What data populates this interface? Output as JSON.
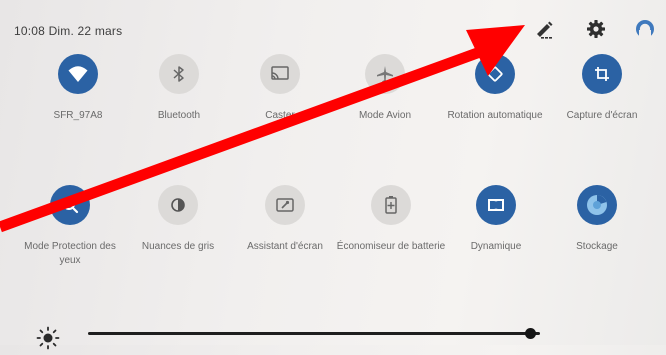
{
  "status_bar": {
    "datetime": "10:08  Dim. 22 mars"
  },
  "header_icons": [
    "edit-pencil-icon",
    "gear-icon",
    "account-icon"
  ],
  "tiles_row1": [
    {
      "label": "SFR_97A8",
      "state": "on",
      "icon": "wifi-icon"
    },
    {
      "label": "Bluetooth",
      "state": "off",
      "icon": "bluetooth-icon"
    },
    {
      "label": "Caster",
      "state": "off",
      "icon": "cast-icon"
    },
    {
      "label": "Mode Avion",
      "state": "off",
      "icon": "airplane-icon"
    },
    {
      "label": "Rotation automatique",
      "state": "on",
      "icon": "rotation-icon"
    },
    {
      "label": "Capture d'écran",
      "state": "on",
      "icon": "crop-icon"
    }
  ],
  "tiles_row2": [
    {
      "label": "Mode Protection des yeux",
      "state": "on",
      "icon": "eye-protection-icon"
    },
    {
      "label": "Nuances de gris",
      "state": "off",
      "icon": "grayscale-icon"
    },
    {
      "label": "Assistant d'écran",
      "state": "off",
      "icon": "screen-assistant-icon"
    },
    {
      "label": "Économiseur de batterie",
      "state": "off",
      "icon": "battery-saver-icon"
    },
    {
      "label": "Dynamique",
      "state": "on",
      "icon": "dolby-icon"
    },
    {
      "label": "Stockage",
      "state": "on",
      "icon": "storage-icon"
    }
  ],
  "brightness": {
    "icon": "brightness-icon",
    "level": 0.98
  },
  "colors": {
    "accent": "#2b62a4",
    "tile_off": "#dcdad8",
    "annotation": "#ff0000"
  }
}
